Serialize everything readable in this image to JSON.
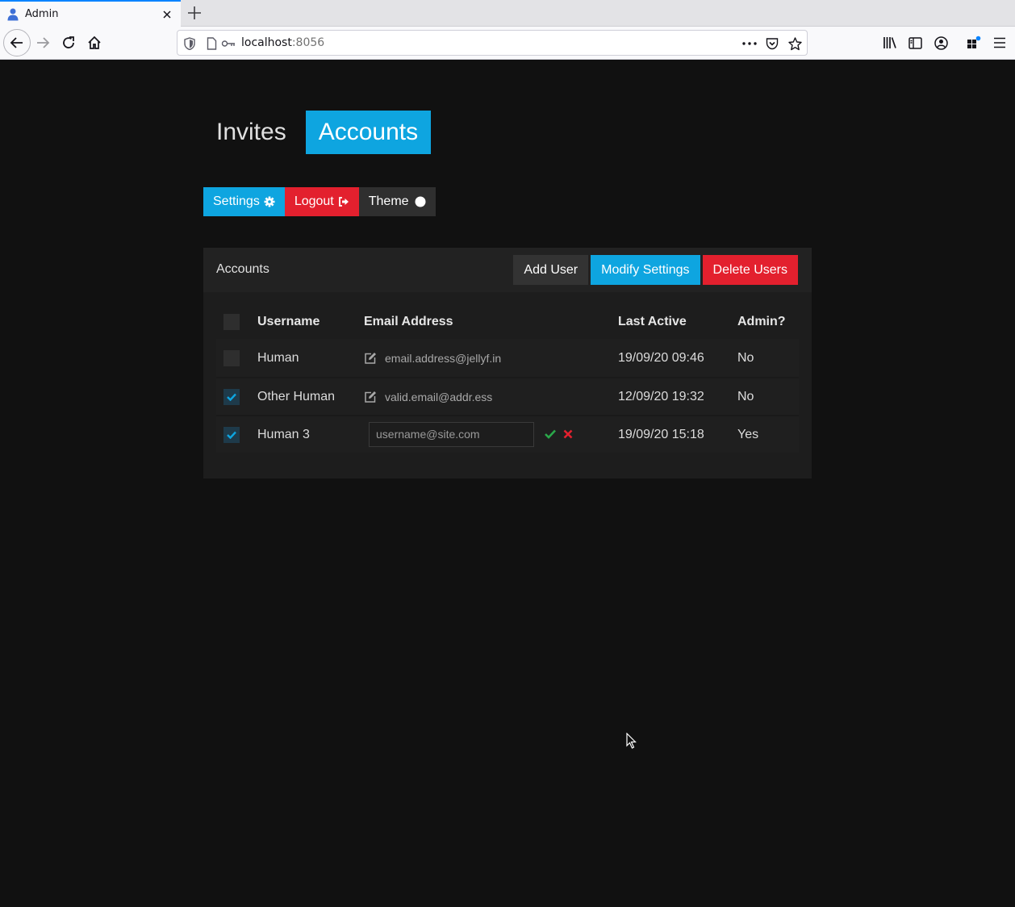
{
  "browser": {
    "tab_title": "Admin",
    "url_host": "localhost",
    "url_port": ":8056",
    "icons": [
      "admin-user-favicon",
      "close-icon",
      "plus-icon",
      "back-arrow-icon",
      "forward-arrow-icon",
      "reload-icon",
      "home-icon",
      "shield-icon",
      "page-icon",
      "key-icon",
      "more-dots-icon",
      "pocket-icon",
      "star-icon",
      "library-icon",
      "sidebar-icon",
      "account-icon",
      "extensions-icon",
      "hamburger-menu-icon"
    ]
  },
  "nav": {
    "tabs": [
      {
        "label": "Invites",
        "active": false
      },
      {
        "label": "Accounts",
        "active": true
      }
    ]
  },
  "actions": {
    "settings_label": "Settings",
    "logout_label": "Logout",
    "theme_label": "Theme"
  },
  "accounts": {
    "title": "Accounts",
    "add_user_label": "Add User",
    "modify_settings_label": "Modify Settings",
    "delete_users_label": "Delete Users",
    "columns": [
      "Username",
      "Email Address",
      "Last Active",
      "Admin?"
    ],
    "rows": [
      {
        "checked": false,
        "username": "Human",
        "email": "email.address@jellyf.in",
        "last_active": "19/09/20 09:46",
        "admin": "No",
        "editing": false
      },
      {
        "checked": true,
        "username": "Other Human",
        "email": "valid.email@addr.ess",
        "last_active": "12/09/20 19:32",
        "admin": "No",
        "editing": false
      },
      {
        "checked": true,
        "username": "Human 3",
        "email_placeholder": "username@site.com",
        "last_active": "19/09/20 15:18",
        "admin": "Yes",
        "editing": true
      }
    ]
  },
  "colors": {
    "accent_blue": "#0ea5e0",
    "danger_red": "#e3202e",
    "background": "#111111",
    "confirm_green": "#2aa84a"
  }
}
